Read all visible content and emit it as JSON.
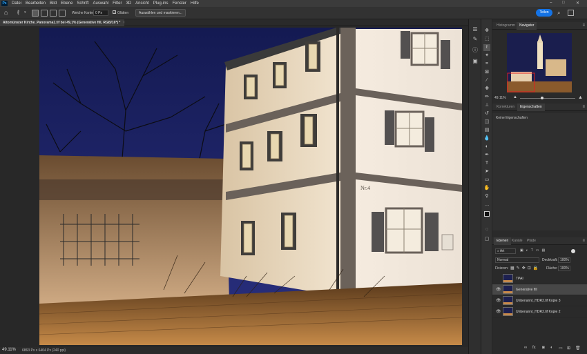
{
  "app": {
    "logo": "Ps",
    "menu": [
      "Datei",
      "Bearbeiten",
      "Bild",
      "Ebene",
      "Schrift",
      "Auswahl",
      "Filter",
      "3D",
      "Ansicht",
      "Plug-ins",
      "Fenster",
      "Hilfe"
    ],
    "window_controls": [
      "–",
      "□",
      "✕"
    ]
  },
  "options_bar": {
    "soft_edge_label": "Weiche Kante:",
    "soft_edge_value": "0 Px",
    "smooth_label": "Glätten",
    "select_mask_button": "Auswählen und maskieren...",
    "share_button": "Teilen"
  },
  "document": {
    "tab_title": "Altomünster Kirche_Panorama1.tif bei 49,1% (Generative fill, RGB/16*) *",
    "tab_close": "×",
    "house_number": "Nr.4"
  },
  "status": {
    "zoom": "49.11%",
    "doc_info": "6863 Px x 6404 Px (240 ppi)"
  },
  "navigator": {
    "tabs": [
      "Histogramm",
      "Navigator"
    ],
    "active_tab": "Navigator",
    "zoom": "49.11%"
  },
  "properties": {
    "tabs": [
      "Korrekturen",
      "Eigenschaften"
    ],
    "active_tab": "Eigenschaften",
    "empty_text": "Keine Eigenschaften"
  },
  "layers": {
    "tabs": [
      "Ebenen",
      "Kanäle",
      "Pfade"
    ],
    "active_tab": "Ebenen",
    "filter_kind": "Art",
    "blend_mode": "Normal",
    "opacity_label": "Deckkraft:",
    "opacity_value": "100%",
    "lock_label": "Fixieren:",
    "fill_label": "Fläche:",
    "fill_value": "100%",
    "items": [
      {
        "name": "TPAI",
        "visible": false,
        "selected": false
      },
      {
        "name": "Generative fill",
        "visible": true,
        "selected": true
      },
      {
        "name": "Unbenannt_HDR2.tif Kopie 3",
        "visible": true,
        "selected": false
      },
      {
        "name": "Unbenannt_HDR2.tif Kopie 2",
        "visible": true,
        "selected": false
      }
    ]
  },
  "colors": {
    "accent": "#1473e6",
    "sky": "#1e2368",
    "wall": "#efe2cc",
    "shutters": "#5a5a5a"
  }
}
